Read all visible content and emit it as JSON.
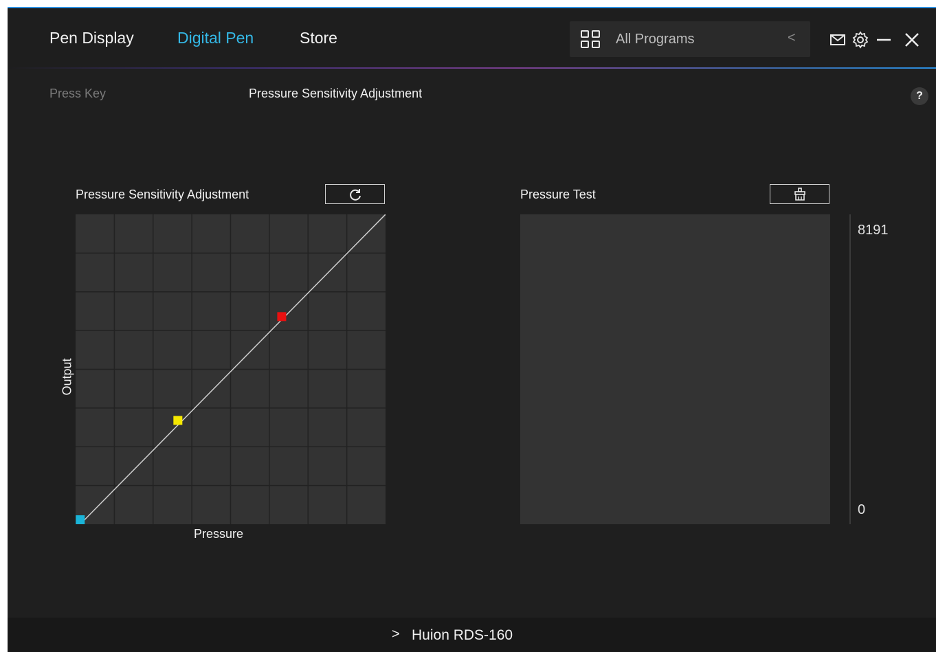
{
  "header": {
    "tabs": [
      {
        "label": "Pen Display",
        "active": false
      },
      {
        "label": "Digital Pen",
        "active": true
      },
      {
        "label": "Store",
        "active": false
      }
    ],
    "program_selector": {
      "label": "All Programs",
      "icon": "grid-icon",
      "arrow": "<"
    },
    "icons": [
      "mail-icon",
      "gear-icon",
      "minimize-icon",
      "close-icon"
    ],
    "accent_color": "#34b8e6"
  },
  "subtabs": {
    "press_key": "Press Key",
    "pressure_sensitivity": "Pressure Sensitivity Adjustment",
    "help": "?"
  },
  "curve_panel": {
    "title": "Pressure Sensitivity Adjustment",
    "reset_icon": "refresh-icon",
    "x_label": "Pressure",
    "y_label": "Output",
    "grid_divisions": 8,
    "control_points": [
      {
        "name": "start",
        "pressure": 0.015,
        "output": 0.0,
        "color": "#1ab4d8"
      },
      {
        "name": "low",
        "pressure": 0.33,
        "output": 0.335,
        "color": "#f5e800"
      },
      {
        "name": "high",
        "pressure": 0.665,
        "output": 0.67,
        "color": "#e81010"
      }
    ]
  },
  "test_panel": {
    "title": "Pressure Test",
    "clear_icon": "brush-clear-icon",
    "max_label": "8191",
    "min_label": "0",
    "current_level": 0
  },
  "footer": {
    "chevron": ">",
    "device": "Huion RDS-160"
  }
}
